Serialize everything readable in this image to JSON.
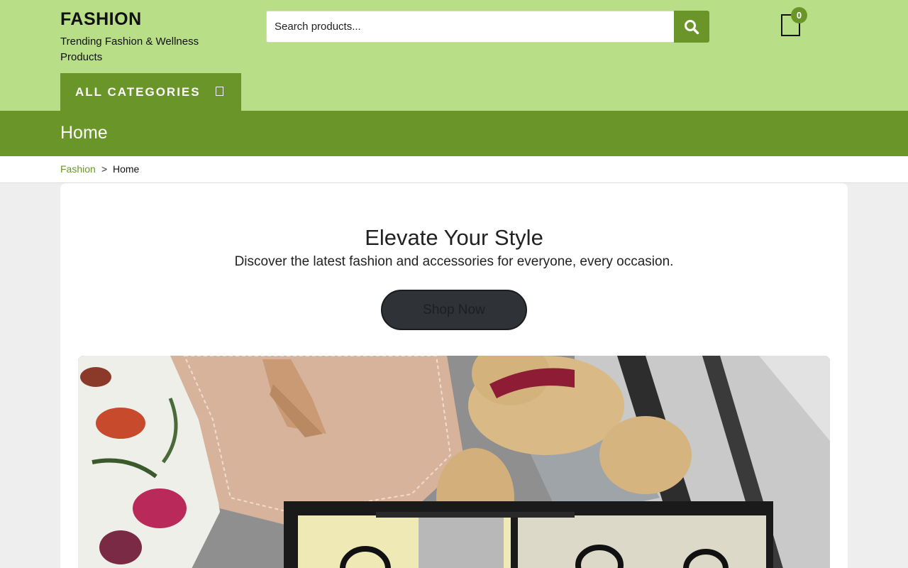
{
  "header": {
    "site_title": "FASHION",
    "tagline": "Trending Fashion & Wellness Products",
    "search_placeholder": "Search products...",
    "search_icon": "search-icon",
    "cart_icon": "shopping-bag-icon",
    "cart_count": "0",
    "all_categories_label": "ALL CATEGORIES",
    "all_categories_icon": "menu-icon"
  },
  "titlebar": {
    "title": "Home"
  },
  "breadcrumb": {
    "home_link": "Fashion",
    "separator": ">",
    "current": "Home"
  },
  "hero": {
    "title": "Elevate Your Style",
    "subtitle": "Discover the latest fashion and accessories for everyone, every occasion.",
    "button_label": "Shop Now",
    "image_description_icon": "hero-image"
  },
  "colors": {
    "header_bg": "#b8de88",
    "accent": "#6a9629",
    "page_bg": "#eeeeee",
    "button_dark": "#2f3237"
  }
}
